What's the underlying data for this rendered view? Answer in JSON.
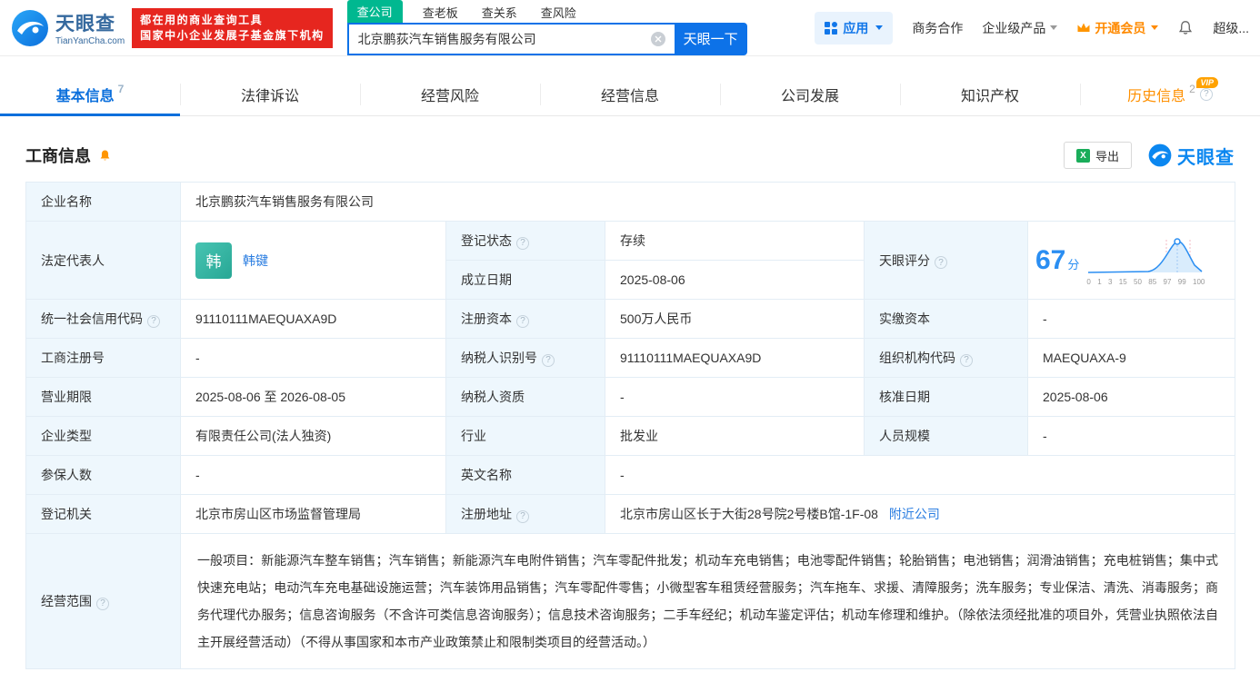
{
  "header": {
    "logo": {
      "name": "天眼查",
      "domain": "TianYanCha.com"
    },
    "badge": {
      "line1": "都在用的商业查询工具",
      "line2": "国家中小企业发展子基金旗下机构"
    },
    "search": {
      "tabs": [
        {
          "label": "查公司"
        },
        {
          "label": "查老板"
        },
        {
          "label": "查关系"
        },
        {
          "label": "查风险"
        }
      ],
      "value": "北京鹏荻汽车销售服务有限公司",
      "button": "天眼一下"
    },
    "nav": {
      "apps": "应用",
      "biz": "商务合作",
      "enterprise": "企业级产品",
      "member": "开通会员",
      "super": "超级..."
    }
  },
  "nav_tabs": [
    {
      "label": "基本信息",
      "count": "7"
    },
    {
      "label": "法律诉讼"
    },
    {
      "label": "经营风险"
    },
    {
      "label": "经营信息"
    },
    {
      "label": "公司发展"
    },
    {
      "label": "知识产权"
    },
    {
      "label": "历史信息",
      "count": "2",
      "vip_tag": "VIP"
    }
  ],
  "section": {
    "title": "工商信息",
    "export_label": "导出",
    "brand": "天眼查"
  },
  "colors": {
    "accent_blue": "#0d72e8",
    "status_green": "#00b276",
    "vip_orange": "#ff8a00",
    "badge_red": "#e6261f"
  },
  "info": {
    "company_name": {
      "label": "企业名称",
      "value": "北京鹏荻汽车销售服务有限公司"
    },
    "legal_rep": {
      "label": "法定代表人",
      "avatar": "韩",
      "name": "韩键"
    },
    "reg_status": {
      "label": "登记状态",
      "value": "存续"
    },
    "establish_date": {
      "label": "成立日期",
      "value": "2025-08-06"
    },
    "score": {
      "label": "天眼评分",
      "value": "67",
      "unit": "分",
      "axis": [
        "0",
        "1",
        "3",
        "15",
        "50",
        "85",
        "97",
        "99",
        "100"
      ]
    },
    "credit_code": {
      "label": "统一社会信用代码",
      "value": "91110111MAEQUAXA9D"
    },
    "reg_capital": {
      "label": "注册资本",
      "value": "500万人民币"
    },
    "paid_capital": {
      "label": "实缴资本",
      "value": "-"
    },
    "reg_number": {
      "label": "工商注册号",
      "value": "-"
    },
    "taxpayer_id": {
      "label": "纳税人识别号",
      "value": "91110111MAEQUAXA9D"
    },
    "org_code": {
      "label": "组织机构代码",
      "value": "MAEQUAXA-9"
    },
    "business_term": {
      "label": "营业期限",
      "value": "2025-08-06 至 2026-08-05"
    },
    "taxpayer_quality": {
      "label": "纳税人资质",
      "value": "-"
    },
    "approval_date": {
      "label": "核准日期",
      "value": "2025-08-06"
    },
    "company_type": {
      "label": "企业类型",
      "value": "有限责任公司(法人独资)"
    },
    "industry": {
      "label": "行业",
      "value": "批发业"
    },
    "staff_size": {
      "label": "人员规模",
      "value": "-"
    },
    "insured_count": {
      "label": "参保人数",
      "value": "-"
    },
    "english_name": {
      "label": "英文名称",
      "value": "-"
    },
    "reg_authority": {
      "label": "登记机关",
      "value": "北京市房山区市场监督管理局"
    },
    "reg_address": {
      "label": "注册地址",
      "value": "北京市房山区长于大街28号院2号楼B馆-1F-08",
      "link": "附近公司"
    },
    "business_scope": {
      "label": "经营范围",
      "value": "一般项目：新能源汽车整车销售；汽车销售；新能源汽车电附件销售；汽车零配件批发；机动车充电销售；电池零配件销售；轮胎销售；电池销售；润滑油销售；充电桩销售；集中式快速充电站；电动汽车充电基础设施运营；汽车装饰用品销售；汽车零配件零售；小微型客车租赁经营服务；汽车拖车、求援、清障服务；洗车服务；专业保洁、清洗、消毒服务；商务代理代办服务；信息咨询服务（不含许可类信息咨询服务）；信息技术咨询服务；二手车经纪；机动车鉴定评估；机动车修理和维护。（除依法须经批准的项目外，凭营业执照依法自主开展经营活动）（不得从事国家和本市产业政策禁止和限制类项目的经营活动。）"
    }
  }
}
